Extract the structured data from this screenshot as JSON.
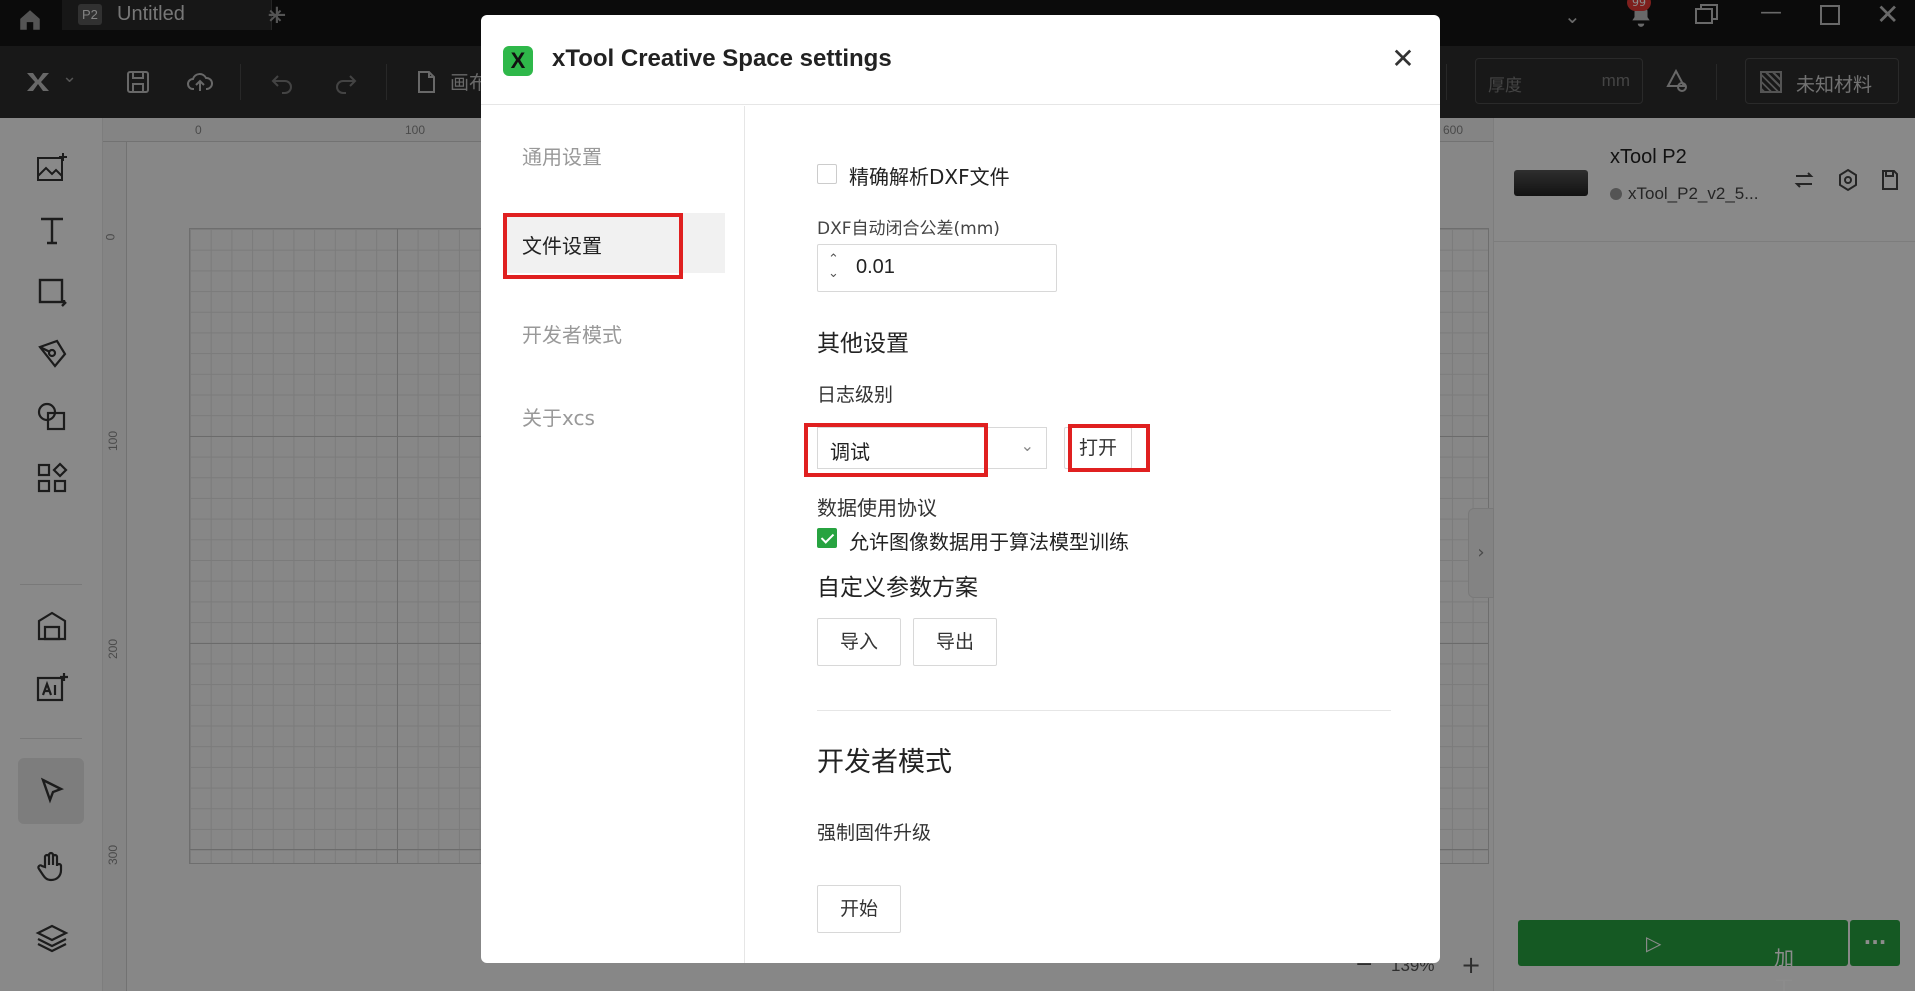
{
  "titlebar": {
    "tab_badge": "P2",
    "tab_title": "Untitled",
    "notification_count": "99"
  },
  "toolbar": {
    "canvas_label": "画布",
    "thickness_placeholder": "厚度",
    "thickness_unit": "mm",
    "material_label": "未知材料"
  },
  "canvas": {
    "ruler_top": [
      "0",
      "100",
      "600"
    ],
    "ruler_left": [
      "0",
      "100",
      "200",
      "300"
    ],
    "zoom": "139%"
  },
  "device": {
    "name": "xTool P2",
    "connection": "xTool_P2_v2_5...",
    "process_label": "加工",
    "more_label": "···"
  },
  "dialog": {
    "title": "xTool Creative Space settings",
    "logo_letter": "X",
    "nav": [
      {
        "label": "通用设置"
      },
      {
        "label": "文件设置"
      },
      {
        "label": "开发者模式"
      },
      {
        "label": "关于xcs"
      }
    ],
    "file": {
      "dxf_precise_label": "精确解析DXF文件",
      "dxf_precise_checked": false,
      "tolerance_label": "DXF自动闭合公差(mm)",
      "tolerance_value": "0.01"
    },
    "other": {
      "heading": "其他设置",
      "log_level_label": "日志级别",
      "log_level_value": "调试",
      "open_button": "打开",
      "data_agreement_label": "数据使用协议",
      "allow_image_label": "允许图像数据用于算法模型训练",
      "allow_image_checked": true,
      "custom_params_heading": "自定义参数方案",
      "import_button": "导入",
      "export_button": "导出"
    },
    "developer": {
      "heading": "开发者模式",
      "force_upgrade_label": "强制固件升级",
      "start_button": "开始"
    }
  },
  "colors": {
    "accent_green": "#27a340",
    "highlight_red": "#e02020"
  }
}
